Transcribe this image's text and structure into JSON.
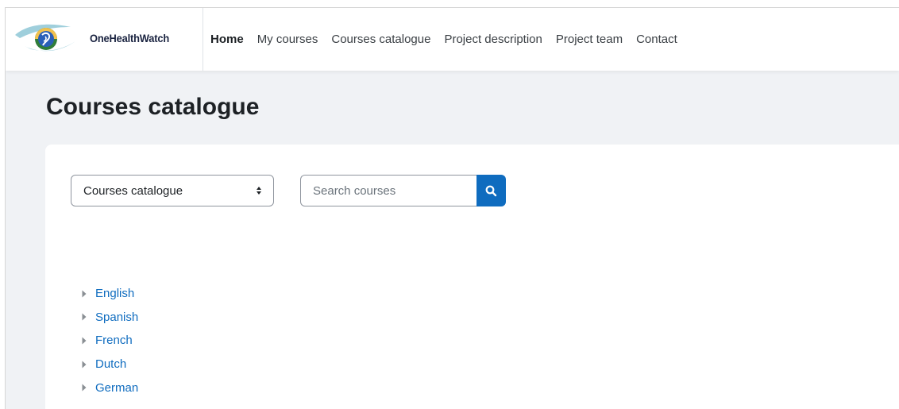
{
  "header": {
    "brand_name": "OneHealthWatch",
    "nav": [
      {
        "label": "Home",
        "active": true
      },
      {
        "label": "My courses"
      },
      {
        "label": "Courses catalogue"
      },
      {
        "label": "Project description"
      },
      {
        "label": "Project team"
      },
      {
        "label": "Contact"
      }
    ]
  },
  "page": {
    "title": "Courses catalogue"
  },
  "filters": {
    "category_select_value": "Courses catalogue",
    "search_placeholder": "Search courses",
    "search_icon": "search-icon"
  },
  "categories": [
    {
      "label": "English",
      "icon": "caret-right-icon"
    },
    {
      "label": "Spanish",
      "icon": "caret-right-icon"
    },
    {
      "label": "French",
      "icon": "caret-right-icon"
    },
    {
      "label": "Dutch",
      "icon": "caret-right-icon"
    },
    {
      "label": "German",
      "icon": "caret-right-icon"
    }
  ],
  "colors": {
    "accent": "#0f6cbf",
    "page_background": "#f0f2f5",
    "text": "#1d2125"
  }
}
